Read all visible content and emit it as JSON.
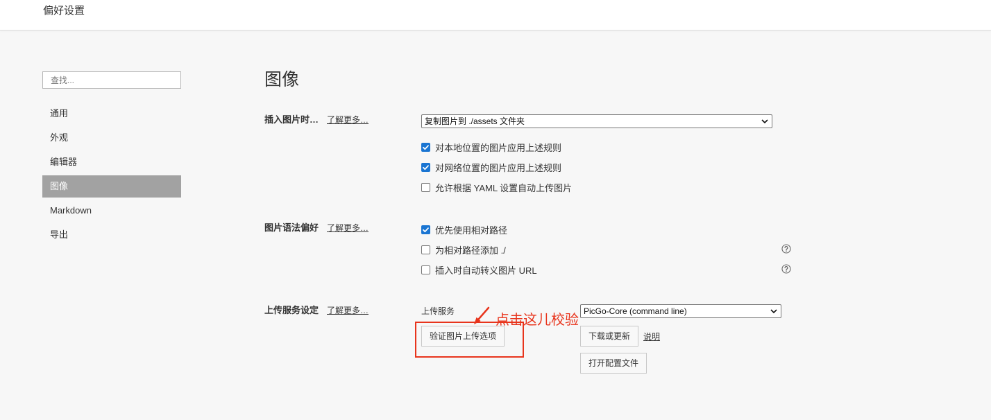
{
  "window": {
    "title": "偏好设置"
  },
  "sidebar": {
    "search": {
      "placeholder": "查找..."
    },
    "items": [
      {
        "label": "通用",
        "selected": false
      },
      {
        "label": "外观",
        "selected": false
      },
      {
        "label": "编辑器",
        "selected": false
      },
      {
        "label": "图像",
        "selected": true
      },
      {
        "label": "Markdown",
        "selected": false
      },
      {
        "label": "导出",
        "selected": false
      }
    ]
  },
  "main": {
    "title": "图像",
    "insert": {
      "label": "插入图片时…",
      "learn_more": "了解更多…",
      "action_select": "复制图片到 ./assets 文件夹",
      "options": [
        {
          "label": "对本地位置的图片应用上述规则",
          "checked": true
        },
        {
          "label": "对网络位置的图片应用上述规则",
          "checked": true
        },
        {
          "label": "允许根据 YAML 设置自动上传图片",
          "checked": false
        }
      ]
    },
    "syntax": {
      "label": "图片语法偏好",
      "learn_more": "了解更多…",
      "options": [
        {
          "label": "优先使用相对路径",
          "checked": true
        },
        {
          "label": "为相对路径添加 ./",
          "checked": false
        },
        {
          "label": "插入时自动转义图片 URL",
          "checked": false
        }
      ]
    },
    "upload": {
      "label": "上传服务设定",
      "learn_more": "了解更多…",
      "service_label": "上传服务",
      "service_select": "PicGo-Core (command line)",
      "validate_button": "验证图片上传选项",
      "download_button": "下载或更新",
      "instructions_link": "说明",
      "open_config_button": "打开配置文件"
    }
  },
  "annotation": {
    "text": "点击这儿校验"
  },
  "colors": {
    "accent": "#1a75d2",
    "nav_selected_bg": "#a2a2a2",
    "annotation": "#e8341c",
    "page_bg": "#f7f7f7"
  },
  "icons": {
    "dropdown": "chevron-down-icon",
    "checkbox_tick": "checkmark-icon",
    "help": "help-icon",
    "annotation_arrow": "arrow-icon"
  }
}
